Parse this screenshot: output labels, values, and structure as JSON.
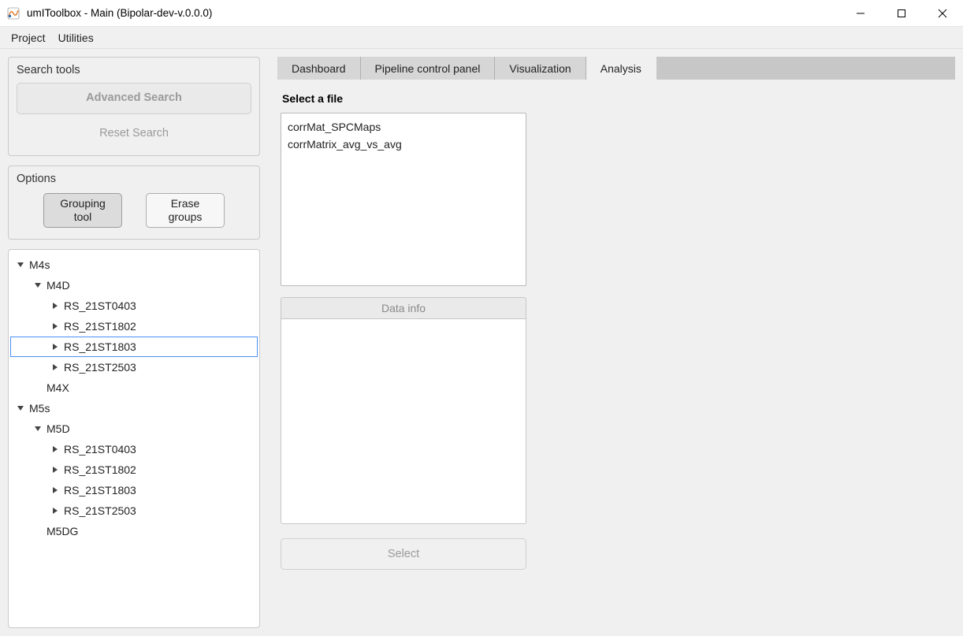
{
  "window": {
    "title": "umIToolbox - Main  (Bipolar-dev-v.0.0.0)"
  },
  "menu": {
    "project": "Project",
    "utilities": "Utilities"
  },
  "search_panel": {
    "title": "Search tools",
    "advanced": "Advanced Search",
    "reset": "Reset Search"
  },
  "options_panel": {
    "title": "Options",
    "grouping": "Grouping\ntool",
    "erase": "Erase\ngroups"
  },
  "tree": [
    {
      "depth": 0,
      "toggle": "down",
      "label": "M4s",
      "selected": false
    },
    {
      "depth": 1,
      "toggle": "down",
      "label": "M4D",
      "selected": false
    },
    {
      "depth": 2,
      "toggle": "right",
      "label": "RS_21ST0403",
      "selected": false
    },
    {
      "depth": 2,
      "toggle": "right",
      "label": "RS_21ST1802",
      "selected": false
    },
    {
      "depth": 2,
      "toggle": "right",
      "label": "RS_21ST1803",
      "selected": true
    },
    {
      "depth": 2,
      "toggle": "right",
      "label": "RS_21ST2503",
      "selected": false
    },
    {
      "depth": 1,
      "toggle": "none",
      "label": "M4X",
      "selected": false
    },
    {
      "depth": 0,
      "toggle": "down",
      "label": "M5s",
      "selected": false
    },
    {
      "depth": 1,
      "toggle": "down",
      "label": "M5D",
      "selected": false
    },
    {
      "depth": 2,
      "toggle": "right",
      "label": "RS_21ST0403",
      "selected": false
    },
    {
      "depth": 2,
      "toggle": "right",
      "label": "RS_21ST1802",
      "selected": false
    },
    {
      "depth": 2,
      "toggle": "right",
      "label": "RS_21ST1803",
      "selected": false
    },
    {
      "depth": 2,
      "toggle": "right",
      "label": "RS_21ST2503",
      "selected": false
    },
    {
      "depth": 1,
      "toggle": "none",
      "label": "M5DG",
      "selected": false
    }
  ],
  "tabs": {
    "dashboard": "Dashboard",
    "pipeline": "Pipeline control panel",
    "viz": "Visualization",
    "analysis": "Analysis",
    "active": "analysis"
  },
  "analysis": {
    "select_file_label": "Select a file",
    "files": [
      "corrMat_SPCMaps",
      "corrMatrix_avg_vs_avg"
    ],
    "data_info_header": "Data info",
    "select_button": "Select"
  }
}
